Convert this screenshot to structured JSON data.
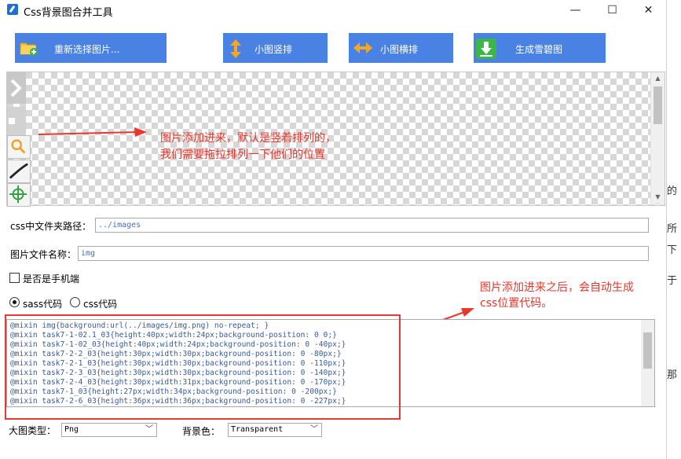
{
  "window": {
    "title": "Css背景图合并工具",
    "min_glyph": "—",
    "max_glyph": "☐",
    "close_glyph": "✕"
  },
  "toolbar": {
    "reselect_label": "重新选择图片...",
    "vertical_label": "小图竖排",
    "horizontal_label": "小图横排",
    "generate_label": "生成雪碧图"
  },
  "canvas": {
    "annotation_line1": "图片添加进来，默认是竖着排列的，",
    "annotation_line2": "我们需要拖拉排列一下他们的位置"
  },
  "form": {
    "css_path_label": "css中文件夹路径：",
    "css_path_value": "../images",
    "image_name_label": "图片文件名称：",
    "image_name_value": "img",
    "mobile_label": "是否是手机端",
    "sass_label": "sass代码",
    "css_label": "css代码"
  },
  "code_annotation": {
    "line1": "图片添加进来之后，会自动生成",
    "line2": "css位置代码。"
  },
  "code_lines": [
    "@mixin img{background:url(../images/img.png) no-repeat; }",
    "@mixin task7-1-02.1_03{height:40px;width:24px;background-position: 0 0;}",
    "@mixin task7-1-02_03{height:40px;width:24px;background-position: 0 -40px;}",
    "@mixin task7-2-2_03{height:30px;width:30px;background-position: 0 -80px;}",
    "@mixin task7-2-1_03{height:30px;width:30px;background-position: 0 -110px;}",
    "@mixin task7-2-3_03{height:30px;width:30px;background-position: 0 -140px;}",
    "@mixin task7-2-4_03{height:30px;width:31px;background-position: 0 -170px;}",
    "@mixin task7-1_03{height:27px;width:34px;background-position: 0 -200px;}",
    "@mixin task7-2-6_03{height:36px;width:36px;background-position: 0 -227px;}"
  ],
  "bottom": {
    "type_label": "大图类型：",
    "type_value": "Png",
    "bg_label": "背景色：",
    "bg_value": "Transparent"
  },
  "background_page": {
    "c1": "的",
    "c2": "所",
    "c3": "下",
    "c4": "于",
    "c5": "那"
  },
  "colors": {
    "button": "#4a82e3",
    "annotation": "#e8372c",
    "code_text": "#3a5a9a"
  }
}
